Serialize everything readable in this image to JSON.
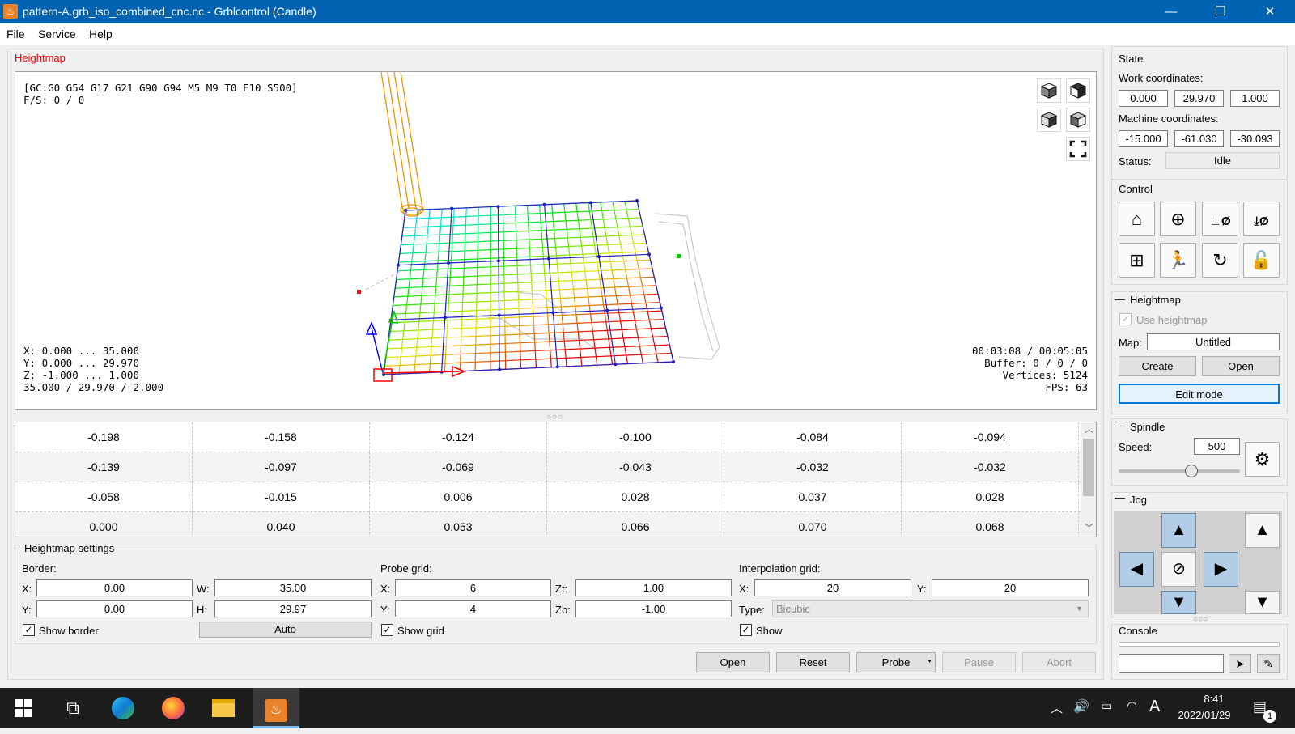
{
  "window": {
    "title": "pattern-A.grb_iso_combined_cnc.nc - Grblcontrol  (Candle)",
    "minimize_label": "—",
    "maximize_label": "❐",
    "close_label": "✕"
  },
  "menu": [
    "File",
    "Service",
    "Help"
  ],
  "viewer": {
    "title": "Heightmap",
    "gcode_state": "[GC:G0 G54 G17 G21 G90 G94 M5 M9 T0 F10 S500]",
    "fs": "F/S: 0 / 0",
    "bounds_x": "X: 0.000 ... 35.000",
    "bounds_y": "Y: 0.000 ... 29.970",
    "bounds_z": "Z: -1.000 ... 1.000",
    "size": "35.000 / 29.970 / 2.000",
    "time": "00:03:08 / 00:05:05",
    "buffer": "Buffer: 0 / 0 / 0",
    "vertices": "Vertices: 5124",
    "fps": "FPS: 63"
  },
  "heightmap_table": [
    [
      "-0.198",
      "-0.158",
      "-0.124",
      "-0.100",
      "-0.084",
      "-0.094"
    ],
    [
      "-0.139",
      "-0.097",
      "-0.069",
      "-0.043",
      "-0.032",
      "-0.032"
    ],
    [
      "-0.058",
      "-0.015",
      "0.006",
      "0.028",
      "0.037",
      "0.028"
    ],
    [
      "0.000",
      "0.040",
      "0.053",
      "0.066",
      "0.070",
      "0.068"
    ]
  ],
  "settings": {
    "title": "Heightmap settings",
    "border_label": "Border:",
    "x_label": "X:",
    "y_label": "Y:",
    "w_label": "W:",
    "h_label": "H:",
    "border_x": "0.00",
    "border_y": "0.00",
    "border_w": "35.00",
    "border_h": "29.97",
    "show_border": "Show border",
    "auto": "Auto",
    "probe_grid_label": "Probe grid:",
    "probe_x": "6",
    "probe_y": "4",
    "zt_label": "Zt:",
    "zb_label": "Zb:",
    "zt": "1.00",
    "zb": "-1.00",
    "show_grid": "Show grid",
    "interp_label": "Interpolation grid:",
    "interp_x": "20",
    "interp_y": "20",
    "type_label": "Type:",
    "type_value": "Bicubic",
    "show": "Show"
  },
  "bottom_buttons": {
    "open": "Open",
    "reset": "Reset",
    "probe": "Probe",
    "pause": "Pause",
    "abort": "Abort"
  },
  "state": {
    "title": "State",
    "work_label": "Work coordinates:",
    "work": [
      "0.000",
      "29.970",
      "1.000"
    ],
    "machine_label": "Machine coordinates:",
    "machine": [
      "-15.000",
      "-61.030",
      "-30.093"
    ],
    "status_label": "Status:",
    "status": "Idle"
  },
  "control": {
    "title": "Control",
    "icons": [
      "home-icon",
      "probe-z-icon",
      "zero-xy-icon",
      "zero-z-icon",
      "restore-origin-icon",
      "safe-position-icon",
      "reset-icon",
      "unlock-icon"
    ]
  },
  "heightmap_panel": {
    "title": "Heightmap",
    "use_heightmap": "Use heightmap",
    "map_label": "Map:",
    "map_value": "Untitled",
    "create": "Create",
    "open": "Open",
    "edit_mode": "Edit mode"
  },
  "spindle": {
    "title": "Spindle",
    "speed_label": "Speed:",
    "speed": "500",
    "slider_fraction": 0.6
  },
  "jog": {
    "title": "Jog"
  },
  "console": {
    "title": "Console",
    "input": ""
  },
  "taskbar": {
    "time": "8:41",
    "date": "2022/01/29",
    "ime": "A",
    "notification_count": "1"
  }
}
